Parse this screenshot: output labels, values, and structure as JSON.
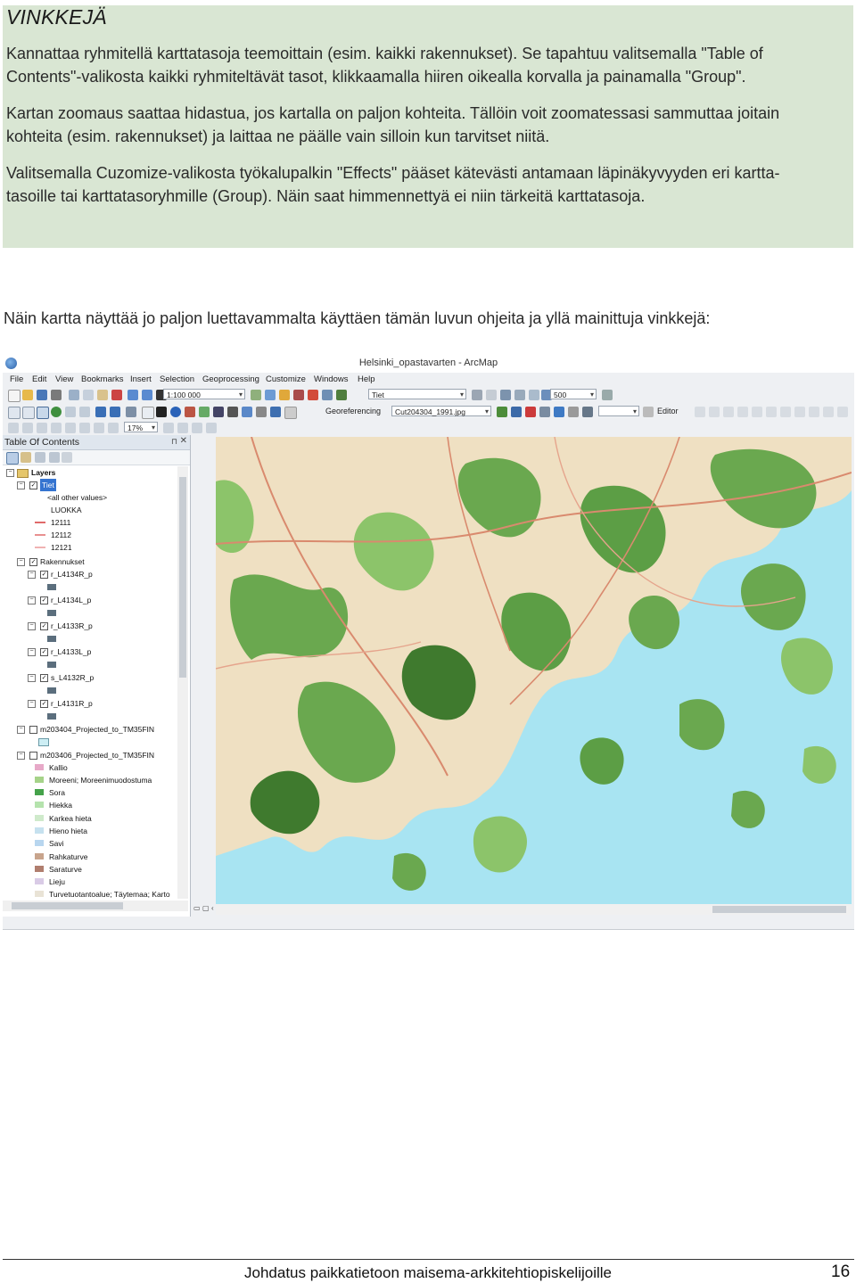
{
  "tips": {
    "title": "VINKKEJÄ",
    "p1_line1": "Kannattaa ryhmitellä karttatasoja teemoittain (esim. kaikki rakennukset). Se tapahtuu valitsemalla \"Table of",
    "p1_line2": "Contents\"-valikosta kaikki ryhmiteltävät tasot, klikkaamalla hiiren oikealla korvalla ja painamalla \"Group\".",
    "p2_line1": "Kartan zoomaus saattaa hidastua, jos kartalla on paljon kohteita. Tällöin voit zoomatessasi sammuttaa joitain",
    "p2_line2": "kohteita (esim. rakennukset) ja laittaa ne päälle vain silloin kun tarvitset niitä.",
    "p3_line1": "Valitsemalla Cuzomize-valikosta työkalupalkin \"Effects\" pääset kätevästi antamaan läpinäkyvyyden eri kartta-",
    "p3_line2": "tasoille tai karttatasoryhmille (Group). Näin saat himmennettyä ei niin tärkeitä karttatasoja."
  },
  "intro": "Näin kartta näyttää jo paljon luettavammalta käyttäen tämän luvun ohjeita ja yllä mainittuja vinkkejä:",
  "arcmap": {
    "window_title": "Helsinki_opastavarten - ArcMap",
    "menu": [
      "File",
      "Edit",
      "View",
      "Bookmarks",
      "Insert",
      "Selection",
      "Geoprocessing",
      "Customize",
      "Windows",
      "Help"
    ],
    "scale": "1:100 000",
    "layer_combo": "Tiet",
    "transparency_value": "500",
    "georef_label": "Georeferencing",
    "georef_layer": "Cut204304_1991.jpg",
    "editor_label": "Editor",
    "zoom_percent": "17%",
    "toc_title": "Table Of Contents",
    "toc_items": {
      "layers": "Layers",
      "tiet": "Tiet",
      "all_other": "<all other values>",
      "luokka": "LUOKKA",
      "c12111": "12111",
      "c12112": "12112",
      "c12121": "12121",
      "rakennukset": "Rakennukset",
      "r1": "r_L4134R_p",
      "r2": "r_L4134L_p",
      "r3": "r_L4133R_p",
      "r4": "r_L4133L_p",
      "r5": "s_L4132R_p",
      "r6": "r_L4131R_p",
      "m1": "m203404_Projected_to_TM35FIN",
      "m2": "m203406_Projected_to_TM35FIN",
      "kallio": "Kallio",
      "moreeni": "Moreeni; Moreenimuodostuma",
      "sora": "Sora",
      "hiekka": "Hiekka",
      "karkea": "Karkea hieta",
      "hieno": "Hieno hieta",
      "savi": "Savi",
      "rahkaturve": "Rahkaturve",
      "saraturve": "Saraturve",
      "lieju": "Lieju",
      "turve": "Turvetuotantoalue; Täytemaa; Karto"
    },
    "colors": {
      "water": "#a8e4f2",
      "forest": "#6aa84f",
      "dark_forest": "#3f7a2e",
      "land": "#efe0c2",
      "roads": "#d98a6e"
    }
  },
  "footer": {
    "title": "Johdatus paikkatietoon maisema-arkkitehtiopiskelijoille",
    "page": "16"
  }
}
